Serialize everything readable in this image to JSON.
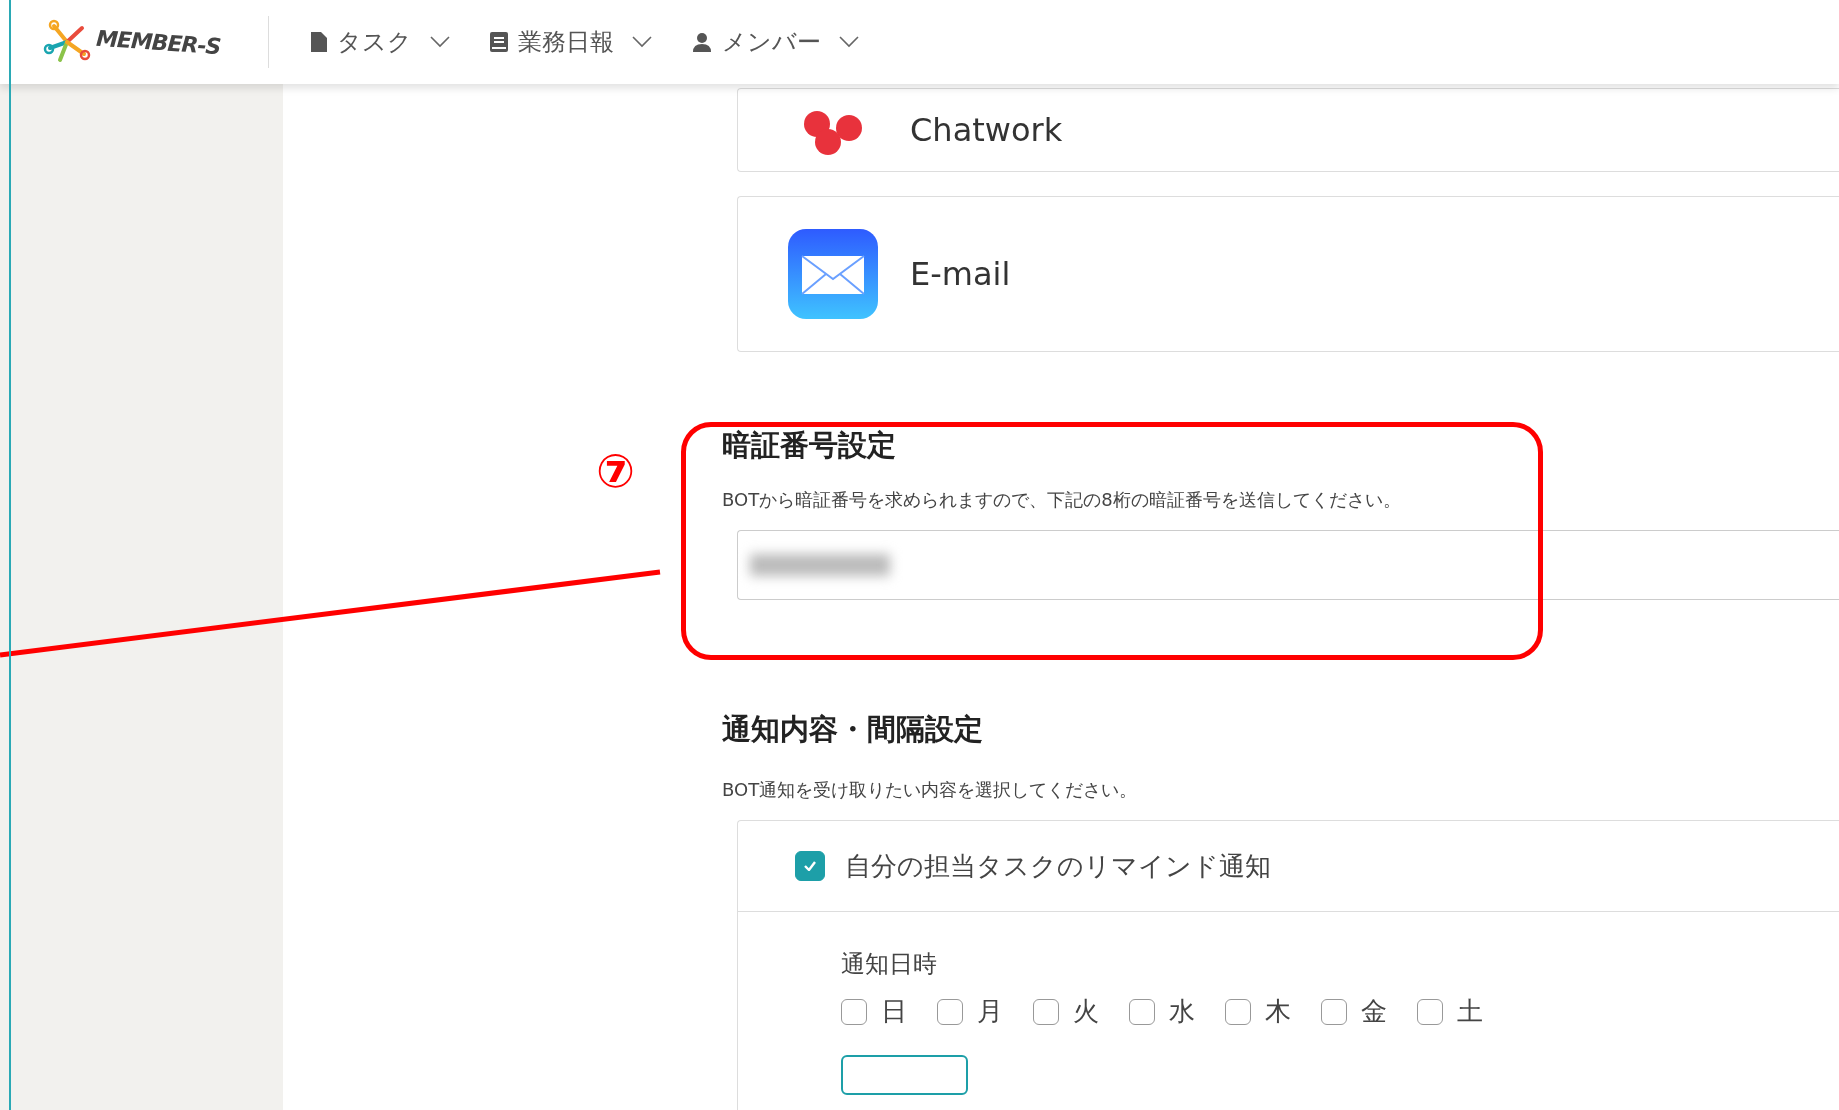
{
  "header": {
    "logo": "MEMBER-S",
    "nav": [
      {
        "label": "タスク",
        "kind": "document"
      },
      {
        "label": "業務日報",
        "kind": "book"
      },
      {
        "label": "メンバー",
        "kind": "person"
      }
    ]
  },
  "channels": [
    {
      "name": "Chatwork",
      "kind": "chatwork"
    },
    {
      "name": "E-mail",
      "kind": "mail"
    }
  ],
  "annotation": {
    "number": "⑦"
  },
  "pin_section": {
    "title": "暗証番号設定",
    "description": "BOTから暗証番号を求められますので、下記の8桁の暗証番号を送信してください。",
    "value_blurred": true
  },
  "notify_section": {
    "title": "通知内容・間隔設定",
    "description": "BOT通知を受け取りたい内容を選択してください。",
    "reminder": {
      "label": "自分の担当タスクのリマインド通知",
      "checked": true
    },
    "schedule_label": "通知日時",
    "days": [
      {
        "label": "日",
        "checked": false
      },
      {
        "label": "月",
        "checked": false
      },
      {
        "label": "火",
        "checked": false
      },
      {
        "label": "水",
        "checked": false
      },
      {
        "label": "木",
        "checked": false
      },
      {
        "label": "金",
        "checked": false
      },
      {
        "label": "土",
        "checked": false
      }
    ]
  }
}
